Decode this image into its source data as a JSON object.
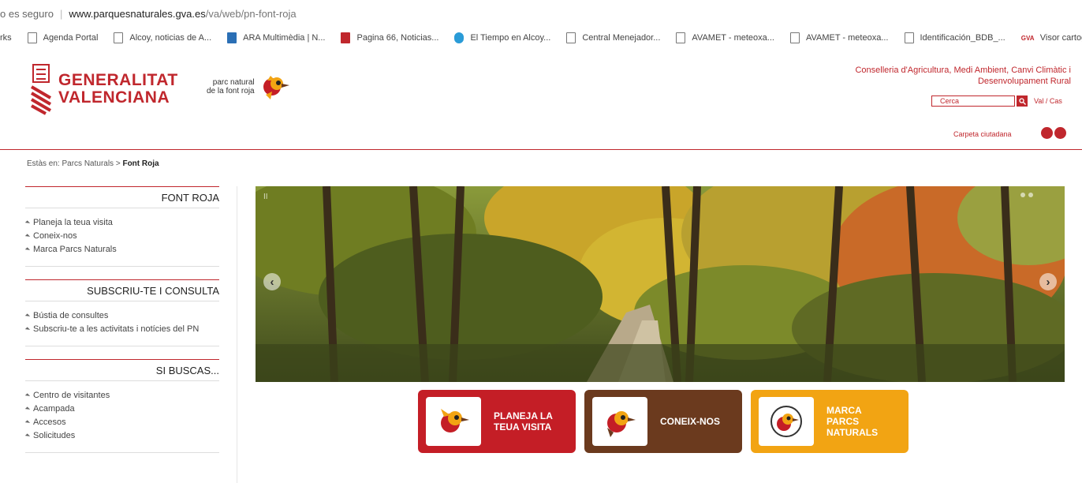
{
  "browser": {
    "insecure_label": "o es seguro",
    "url_host": "www.parquesnaturales.gva.es",
    "url_path": "/va/web/pn-font-roja"
  },
  "bookmarks": [
    {
      "label": "rks",
      "icon": "none"
    },
    {
      "label": "Agenda Portal",
      "icon": "page-icon"
    },
    {
      "label": "Alcoy, noticias de A...",
      "icon": "page-icon"
    },
    {
      "label": "ARA Multimèdia | N...",
      "icon": "ara-icon"
    },
    {
      "label": "Pagina 66, Noticias...",
      "icon": "pagina66-icon"
    },
    {
      "label": "El Tiempo en Alcoy...",
      "icon": "weather-icon"
    },
    {
      "label": "Central Menejador...",
      "icon": "page-icon"
    },
    {
      "label": "AVAMET - meteoxa...",
      "icon": "page-icon"
    },
    {
      "label": "AVAMET - meteoxa...",
      "icon": "page-icon"
    },
    {
      "label": "Identificación_BDB_...",
      "icon": "page-icon"
    },
    {
      "label": "Visor cartogr",
      "icon": "gva-icon"
    }
  ],
  "header": {
    "gv_line1": "GENERALITAT",
    "gv_line2": "VALENCIANA",
    "pn_line1": "parc natural",
    "pn_line2": "de la font roja",
    "conselleria": "Conselleria d'Agricultura, Medi Ambient, Canvi Climàtic i Desenvolupament Rural",
    "search_value": "Cerca",
    "lang": "Val / Cas",
    "carpeta": "Carpeta ciutadana"
  },
  "breadcrumb": {
    "prefix": "Estàs en:",
    "parent": "Parcs Naturals",
    "sep": ">",
    "current": "Font Roja"
  },
  "sidebar": {
    "sections": [
      {
        "title": "FONT ROJA",
        "items": [
          "Planeja la teua visita",
          "Coneix-nos",
          "Marca Parcs Naturals"
        ]
      },
      {
        "title": "SUBSCRIU-TE I CONSULTA",
        "items": [
          "Bústia de consultes",
          "Subscriu-te a les activitats i notícies del PN"
        ]
      },
      {
        "title": "SI BUSCAS...",
        "items": [
          "Centro de visitantes",
          "Acampada",
          "Accesos",
          "Solicitudes"
        ]
      }
    ]
  },
  "hero": {
    "pause": "II",
    "prev": "‹",
    "next": "›"
  },
  "ctas": [
    {
      "label": "PLANEJA LA\nTEUA VISITA",
      "color": "#c41e26"
    },
    {
      "label": "CONEIX-NOS",
      "color": "#6b3a1e"
    },
    {
      "label": "MARCA\nPARCS\nNATURALS",
      "color": "#f2a413"
    }
  ],
  "colors": {
    "accent": "#c0272d"
  }
}
